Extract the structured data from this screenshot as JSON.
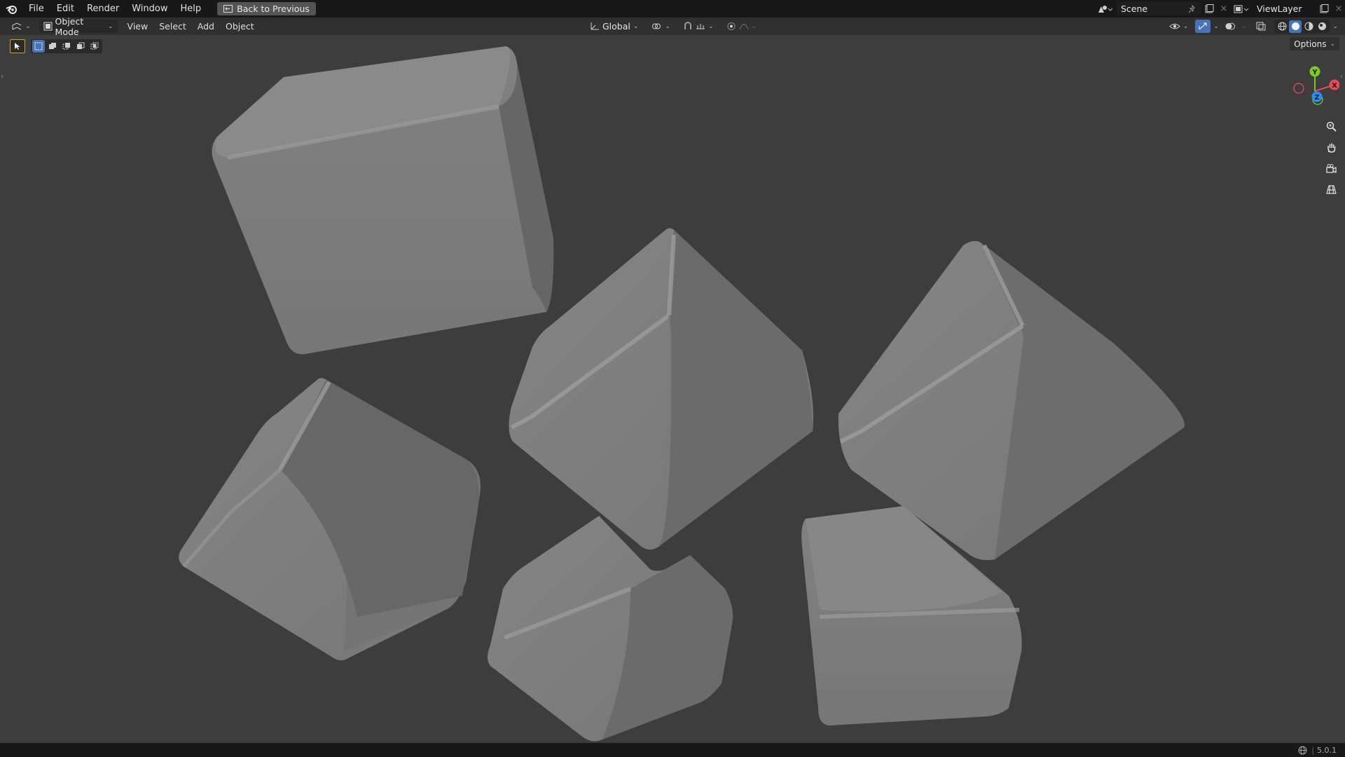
{
  "topbar": {
    "menu": [
      "File",
      "Edit",
      "Render",
      "Window",
      "Help"
    ],
    "back_button": "Back to Previous",
    "scene_name": "Scene",
    "view_layer_name": "ViewLayer"
  },
  "header": {
    "mode": "Object Mode",
    "menus": [
      "View",
      "Select",
      "Add",
      "Object"
    ],
    "orientation": "Global",
    "options": "Options"
  },
  "gizmo": {
    "axis_y": "Y",
    "axis_x": "X",
    "axis_z": "Z",
    "colors": {
      "x": "#e84b58",
      "y": "#7ec928",
      "z": "#2b8ff1"
    }
  },
  "statusbar": {
    "version": "5.0.1"
  },
  "icons": [
    "blender-logo",
    "back-icon",
    "scene-icon",
    "pin-icon",
    "new-scene-icon",
    "close-icon",
    "viewlayer-icon",
    "editor-type-icon",
    "object-mode-icon",
    "orientation-icon",
    "pivot-icon",
    "snap-icon",
    "proportional-icon",
    "select-tool-icon",
    "visibility-icon",
    "gizmo-icon",
    "overlay-icon",
    "xray-icon",
    "wireframe-shading-icon",
    "solid-shading-icon",
    "material-shading-icon",
    "rendered-shading-icon",
    "zoom-icon",
    "pan-icon",
    "camera-icon",
    "grid-icon",
    "globe-icon"
  ]
}
